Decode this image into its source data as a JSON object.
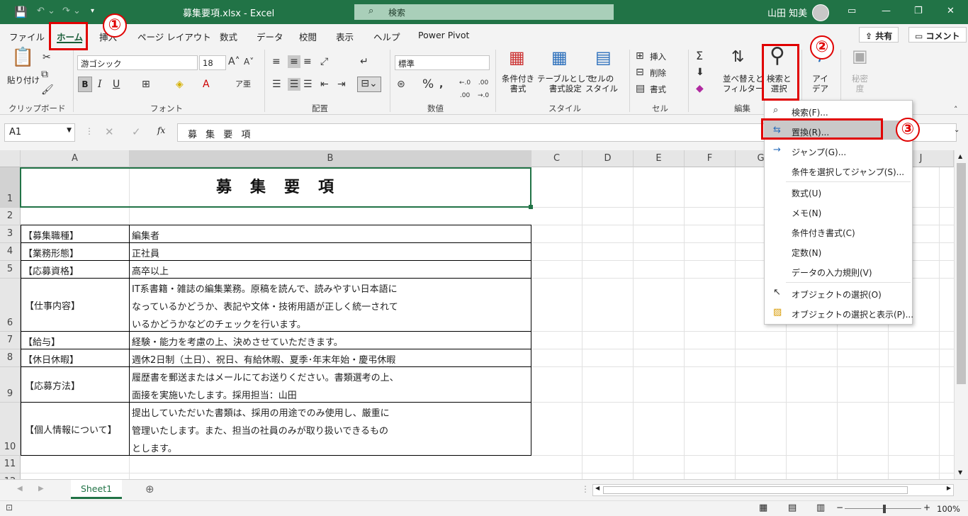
{
  "window": {
    "filename": "募集要項.xlsx  -  Excel",
    "search_placeholder": "検索",
    "user": "山田 知美"
  },
  "tabs": [
    "ファイル",
    "ホーム",
    "挿入",
    "ページ レイアウト",
    "数式",
    "データ",
    "校閲",
    "表示",
    "ヘルプ",
    "Power Pivot"
  ],
  "share_label": "共有",
  "comment_label": "コメント",
  "ribbon": {
    "clipboard": {
      "paste": "貼り付け",
      "label": "クリップボード"
    },
    "font": {
      "name": "游ゴシック",
      "size": "18",
      "label": "フォント"
    },
    "alignment": {
      "label": "配置"
    },
    "number": {
      "format": "標準",
      "label": "数値"
    },
    "styles": {
      "cond": "条件付き\n書式",
      "table": "テーブルとして\n書式設定",
      "cell": "セルの\nスタイル",
      "label": "スタイル"
    },
    "cells": {
      "insert": "挿入",
      "delete": "削除",
      "format": "書式",
      "label": "セル"
    },
    "editing": {
      "sort": "並べ替えと\nフィルター",
      "find": "検索と\n選択",
      "label": "編集"
    },
    "ideas": "アイ\nデア",
    "sensitivity": "秘密\n度"
  },
  "formula_bar": {
    "namebox": "A1",
    "content": "募 集 要 項"
  },
  "columns": [
    "A",
    "B",
    "C",
    "D",
    "E",
    "F",
    "G",
    "H",
    "I",
    "J"
  ],
  "rows": [
    "1",
    "2",
    "3",
    "4",
    "5",
    "6",
    "7",
    "8",
    "9",
    "10",
    "11",
    "12"
  ],
  "sheet": {
    "title": "募　集　要　項",
    "table": [
      {
        "a": "【募集職種】",
        "b": [
          "編集者"
        ]
      },
      {
        "a": "【業務形態】",
        "b": [
          "正社員"
        ]
      },
      {
        "a": "【応募資格】",
        "b": [
          "高卒以上"
        ]
      },
      {
        "a": "【仕事内容】",
        "b": [
          "IT系書籍・雑誌の編集業務。原稿を読んで、読みやすい日本語に",
          "なっているかどうか、表記や文体・技術用語が正しく統一されて",
          "いるかどうかなどのチェックを行います。"
        ]
      },
      {
        "a": "【給与】",
        "b": [
          "経験・能力を考慮の上、決めさせていただきます。"
        ]
      },
      {
        "a": "【休日休暇】",
        "b": [
          "週休2日制（土日）、祝日、有給休暇、夏季･年末年始・慶弔休暇"
        ]
      },
      {
        "a": "【応募方法】",
        "b": [
          "履歴書を郵送またはメールにてお送りください。書類選考の上、",
          "面接を実施いたします。採用担当：山田"
        ]
      },
      {
        "a": "【個人情報について】",
        "b": [
          "提出していただいた書類は、採用の用途でのみ使用し、厳重に",
          "管理いたします。また、担当の社員のみが取り扱いできるもの",
          "とします。"
        ]
      }
    ]
  },
  "find_menu": {
    "items": [
      "検索(F)...",
      "置換(R)...",
      "ジャンプ(G)...",
      "条件を選択してジャンプ(S)...",
      "数式(U)",
      "メモ(N)",
      "条件付き書式(C)",
      "定数(N)",
      "データの入力規則(V)",
      "オブジェクトの選択(O)",
      "オブジェクトの選択と表示(P)..."
    ]
  },
  "callouts": [
    "①",
    "②",
    "③"
  ],
  "sheet_tab": "Sheet1",
  "status": {
    "zoom": "100%"
  }
}
